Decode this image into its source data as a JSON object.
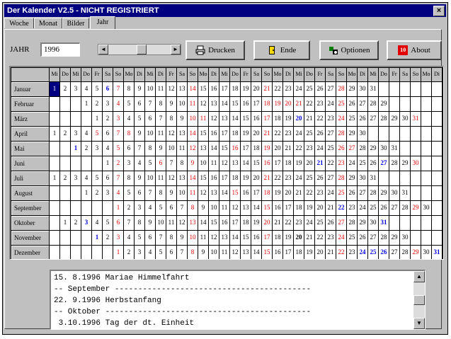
{
  "window": {
    "title": "Der Kalender V2.5 - NICHT REGISTRIERT",
    "close_label": "×"
  },
  "tabs": [
    {
      "label": "Woche"
    },
    {
      "label": "Monat"
    },
    {
      "label": "Bilder"
    },
    {
      "label": "Jahr"
    }
  ],
  "active_tab": "Jahr",
  "toolbar": {
    "jahr_label": "JAHR",
    "jahr_value": "1996",
    "scroll_left": "◄",
    "scroll_right": "►",
    "drucken_label": "Drucken",
    "ende_label": "Ende",
    "optionen_label": "Optionen",
    "about_label": "About",
    "about_icon_text": "10"
  },
  "calendar": {
    "weekday_headers": [
      "Mi",
      "Do",
      "Mi",
      "Do",
      "Fr",
      "Sa",
      "So",
      "Mo",
      "Di",
      "Mi",
      "Di",
      "Fr",
      "Sa",
      "So",
      "Mo",
      "Di",
      "Mi",
      "Do",
      "Fr",
      "Sa",
      "So",
      "Mo",
      "Di",
      "Mi",
      "Do",
      "Fr",
      "Sa",
      "So",
      "Mo",
      "Di",
      "Mi",
      "Do",
      "Fr",
      "Sa",
      "So",
      "Mo",
      "Di"
    ],
    "months": [
      {
        "name": "Januar",
        "offset": 0,
        "days": 31,
        "red": [
          7,
          14,
          21,
          28
        ],
        "blue": [
          6
        ],
        "bold": [],
        "selected": 1
      },
      {
        "name": "Februar",
        "offset": 3,
        "days": 29,
        "red": [
          4,
          11,
          18,
          19,
          20,
          21,
          25
        ],
        "blue": [],
        "bold": [],
        "selected": 0
      },
      {
        "name": "März",
        "offset": 4,
        "days": 31,
        "red": [
          3,
          10,
          11,
          17,
          24,
          31
        ],
        "blue": [
          20
        ],
        "bold": [],
        "selected": 0
      },
      {
        "name": "April",
        "offset": 0,
        "days": 30,
        "red": [
          5,
          7,
          8,
          14,
          21,
          28
        ],
        "blue": [],
        "bold": [],
        "selected": 0
      },
      {
        "name": "Mai",
        "offset": 2,
        "days": 31,
        "red": [
          5,
          12,
          16,
          19,
          26,
          27
        ],
        "blue": [
          1
        ],
        "bold": [],
        "selected": 0
      },
      {
        "name": "Juni",
        "offset": 5,
        "days": 30,
        "red": [
          2,
          6,
          9,
          16,
          23,
          30
        ],
        "blue": [
          21,
          27
        ],
        "bold": [],
        "selected": 0
      },
      {
        "name": "Juli",
        "offset": 0,
        "days": 31,
        "red": [
          7,
          14,
          21,
          28
        ],
        "blue": [],
        "bold": [],
        "selected": 0
      },
      {
        "name": "August",
        "offset": 3,
        "days": 31,
        "red": [
          4,
          11,
          15,
          18,
          25
        ],
        "blue": [],
        "bold": [],
        "selected": 0
      },
      {
        "name": "September",
        "offset": 6,
        "days": 30,
        "red": [
          1,
          8,
          15,
          22,
          29
        ],
        "blue": [
          22
        ],
        "bold": [],
        "selected": 0
      },
      {
        "name": "Oktober",
        "offset": 1,
        "days": 31,
        "red": [
          3,
          6,
          13,
          20,
          27
        ],
        "blue": [
          3,
          31
        ],
        "bold": [],
        "selected": 0
      },
      {
        "name": "November",
        "offset": 4,
        "days": 30,
        "red": [
          1,
          3,
          10,
          17,
          24
        ],
        "blue": [
          1
        ],
        "bold": [
          20
        ],
        "selected": 0
      },
      {
        "name": "Dezember",
        "offset": 6,
        "days": 31,
        "red": [
          1,
          8,
          15,
          22,
          25,
          26,
          29
        ],
        "blue": [
          24,
          25,
          26,
          31
        ],
        "bold": [],
        "selected": 0
      }
    ]
  },
  "memo": {
    "lines": [
      "15. 8.1996 Mariae Himmelfahrt",
      "-- September ------------------------------------------",
      "22. 9.1996 Herbstanfang",
      "-- Oktober --------------------------------------------",
      " 3.10.1996 Tag der dt. Einheit"
    ]
  },
  "colors": {
    "titlebar": "#000080",
    "sunday_holiday": "#e00000",
    "special": "#0000e0",
    "face": "#c0c0c0"
  }
}
